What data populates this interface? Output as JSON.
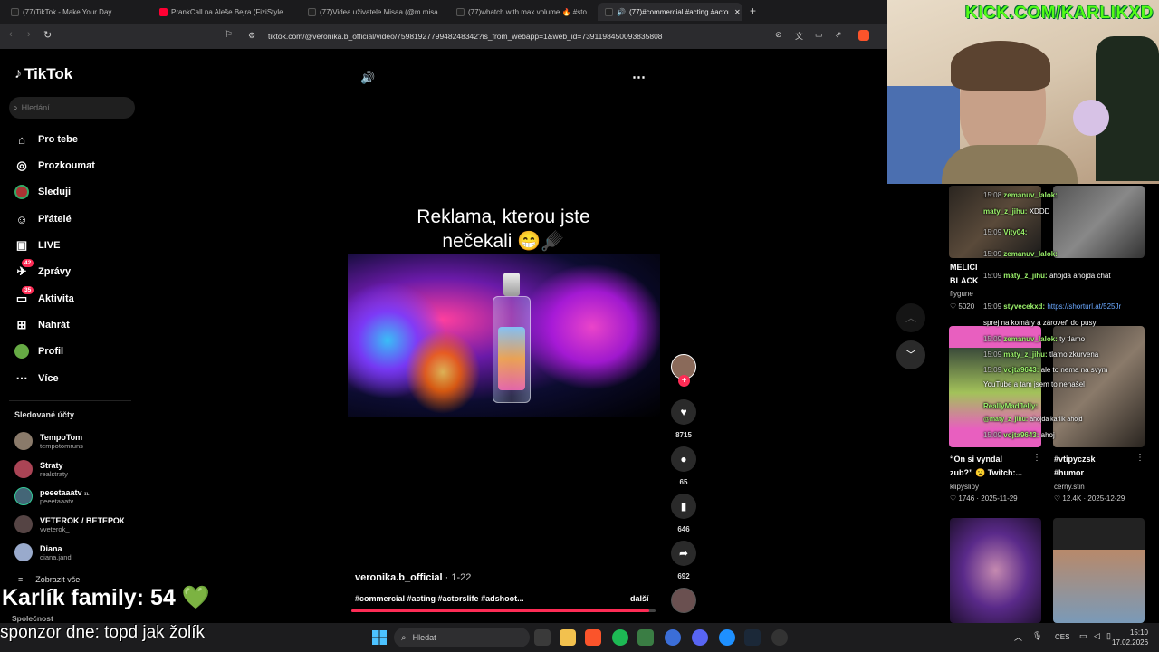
{
  "browser": {
    "tabs": [
      {
        "label": "(77)TikTok - Make Your Day",
        "color": "#111111"
      },
      {
        "label": "PrankCall na Aleše Bejra (FiziStyle",
        "color": "#ff0033"
      },
      {
        "label": "(77)Videa uživatele Misaa (@m.misa",
        "color": "#111111"
      },
      {
        "label": "(77)whatch with max volume 🔥 #sto",
        "color": "#111111"
      },
      {
        "label": "(77)#commercial #acting #actorsl",
        "color": "#111111"
      }
    ],
    "new_tab": "+",
    "close": "✕",
    "url": "tiktok.com/@veronika.b_official/video/7598192779948248342?is_from_webapp=1&web_id=7391198450093835808"
  },
  "tiktok": {
    "logo": "TikTok",
    "search_placeholder": "Hledání",
    "nav": [
      {
        "label": "Pro tebe",
        "icon": "home-icon",
        "glyph": "⌂"
      },
      {
        "label": "Prozkoumat",
        "icon": "compass-icon",
        "glyph": "◎"
      },
      {
        "label": "Sleduji",
        "icon": "following-avatar-icon",
        "glyph": "●"
      },
      {
        "label": "Přátelé",
        "icon": "friends-icon",
        "glyph": "☺"
      },
      {
        "label": "LIVE",
        "icon": "live-icon",
        "glyph": "▣"
      },
      {
        "label": "Zprávy",
        "icon": "messages-icon",
        "glyph": "✈",
        "badge": "42"
      },
      {
        "label": "Aktivita",
        "icon": "activity-icon",
        "glyph": "▭",
        "badge": "35"
      },
      {
        "label": "Nahrát",
        "icon": "upload-icon",
        "glyph": "⊞"
      },
      {
        "label": "Profil",
        "icon": "profile-avatar-icon",
        "glyph": "●"
      },
      {
        "label": "Více",
        "icon": "more-icon",
        "glyph": "⋯"
      }
    ],
    "following_title": "Sledované účty",
    "accounts": [
      {
        "name": "TempoTom",
        "handle": "tempotomruns",
        "color": "#8a7a6a"
      },
      {
        "name": "Straty",
        "handle": "realstraty",
        "color": "#aa4455"
      },
      {
        "name": "peeetaaatv",
        "extra": "ɪʟ",
        "handle": "peeetaaatv",
        "color": "#446677"
      },
      {
        "name": "VETEROK / ВЕТЕРОК",
        "handle": "vveterok_",
        "color": "#554444"
      },
      {
        "name": "Diana",
        "handle": "diana.jand",
        "color": "#99aacc"
      }
    ],
    "show_all": "Zobrazit vše",
    "company": "Společnost",
    "video": {
      "caption_line1": "Reklama, kterou jste",
      "caption_line2": "nečekali 😁🪮",
      "author": "veronika.b_official",
      "date": "· 1-22",
      "hashtags": "#commercial #acting #actorslife #adshoot...",
      "more": "další",
      "likes": "8715",
      "comments": "65",
      "saves": "646",
      "shares": "692",
      "progress": 0.98
    }
  },
  "overlay": {
    "kick_url": "KICK.COM/KARLIKXD",
    "family_count": "Karlík family: 54 💚",
    "sponsor": "sponzor dne: topd jak žolík"
  },
  "side_videos": [
    {
      "title": "MELICI",
      "title2": "BLACK",
      "author": "flygune",
      "stats": "♡ 5020"
    },
    {
      "title": "“On si vyndal",
      "title2": "zub?” 😮 Twitch:...",
      "author": "klipyslipy",
      "stats": "♡ 1746 · 2025-11-29"
    },
    {
      "title": "#vtipyczsk",
      "title2": "#humor",
      "author": "cerny.stin",
      "stats": "♡ 12.4K · 2025-12-29"
    }
  ],
  "chat": [
    {
      "time": "15:08",
      "user": "zemanuv_lalok:",
      "text": ""
    },
    {
      "time": "",
      "user": "maty_z_jihu:",
      "text": "XDDD"
    },
    {
      "time": "15:09",
      "user": "Vity04:",
      "text": ""
    },
    {
      "time": "15:09",
      "user": "zemanuv_lalok:",
      "text": ""
    },
    {
      "time": "15:09",
      "user": "maty_z_jihu:",
      "text": "ahojda   ahojda chat"
    },
    {
      "time": "15:09",
      "user": "styvecekxd:",
      "text": "https://shorturl.at/525Jr"
    },
    {
      "time": "",
      "user": "",
      "text": "sprej na komáry a zároveň do pusy"
    },
    {
      "time": "15:09",
      "user": "zemanuv_lalok:",
      "text": "ty tlamo"
    },
    {
      "time": "15:09",
      "user": "maty_z_jihu:",
      "text": "tlamo zkurvena"
    },
    {
      "time": "15:09",
      "user": "vojta9643:",
      "text": "ale to nema na svym"
    },
    {
      "time": "",
      "user": "",
      "text": "YouTube a tam jsem to nenašel"
    },
    {
      "time": "",
      "user": "ReallyMadJelly:",
      "text": ""
    },
    {
      "time": "",
      "user": "@maty_z_jihu:",
      "text": "ahojda karlik ahojd"
    },
    {
      "time": "15:09",
      "user": "vojta9643:",
      "text": "ahoj"
    }
  ],
  "taskbar": {
    "search": "Hledat",
    "lang": "CES",
    "time": "15:10",
    "date": "17.02.2026"
  }
}
